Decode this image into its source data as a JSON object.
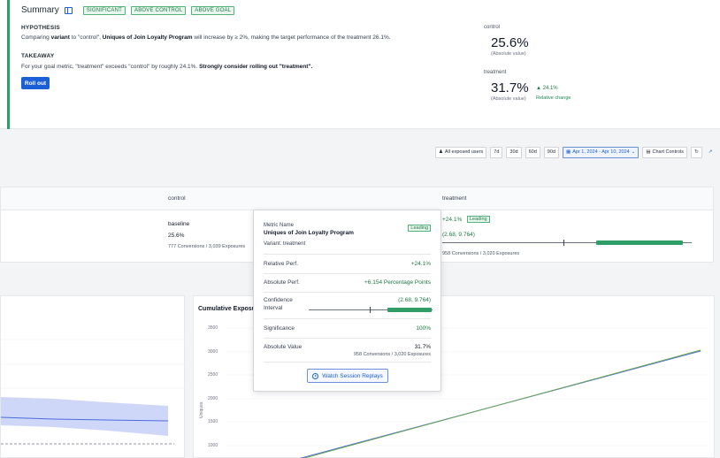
{
  "summary": {
    "title": "Summary",
    "badges": [
      "SIGNIFICANT",
      "ABOVE CONTROL",
      "ABOVE GOAL"
    ],
    "hypothesis_label": "HYPOTHESIS",
    "hypothesis_parts": [
      "Comparing ",
      "variant",
      " to \"control\", ",
      "Uniques of Join Loyalty Program",
      " will increase by ≥ 2%, making the target performance of the treatment 26.1%."
    ],
    "takeaway_label": "TAKEAWAY",
    "takeaway_parts": [
      "For your goal metric, \"treatment\" exceeds \"control\" by roughly 24.1%. ",
      "Strongly consider rolling out \"treatment\"."
    ],
    "rollout_label": "Roll out",
    "control_label": "control",
    "control_value": "25.6%",
    "control_sub": "(Absolute value)",
    "treatment_label": "treatment",
    "treatment_value": "31.7%",
    "treatment_sub": "(Absolute value)",
    "change_value": "▲ 24.1%",
    "change_label": "Relative change"
  },
  "controls": {
    "exposed": "All exposed users",
    "ranges": [
      "7d",
      "30d",
      "60d",
      "90d"
    ],
    "date": "Apr 1, 2024 - Apr 10, 2024",
    "chart_controls": "Chart Controls"
  },
  "table": {
    "col_control": "control",
    "col_treatment": "treatment",
    "baseline_label": "baseline",
    "control_value": "25.6%",
    "control_sub": "777 Conversions / 3,039 Exposures",
    "treatment_change": "+24.1%",
    "treatment_badge": "Leading",
    "treatment_ci": "(2.68, 9.764)",
    "treatment_sub": "958 Conversions / 3,020 Exposures"
  },
  "tooltip": {
    "metric_name_label": "Metric Name",
    "metric_name": "Uniques of Join Loyalty Program",
    "variant": "Variant: treatment",
    "badge": "Leading",
    "rel_label": "Relative Perf.",
    "rel_value": "+24.1%",
    "abs_label": "Absolute Perf.",
    "abs_value": "+6.154 Percentage Points",
    "ci_label_1": "Confidence",
    "ci_label_2": "Interval",
    "ci_value": "(2.68, 9.764)",
    "sig_label": "Significance",
    "sig_value": "100%",
    "absval_label": "Absolute Value",
    "absval_value": "31.7%",
    "absval_sub": "958 Conversions / 3,020 Exposures",
    "replay_label": "Watch Session Replays"
  },
  "charts": {
    "right_title": "Cumulative Exposu",
    "right_yticks": [
      "3500",
      "3000",
      "2500",
      "2000",
      "1500",
      "1000"
    ],
    "right_ylabel": "Uniques"
  },
  "colors": {
    "accent_blue": "#1a5fd6",
    "positive_green": "#2f9e66",
    "band_blue": "#c7d0f7"
  }
}
